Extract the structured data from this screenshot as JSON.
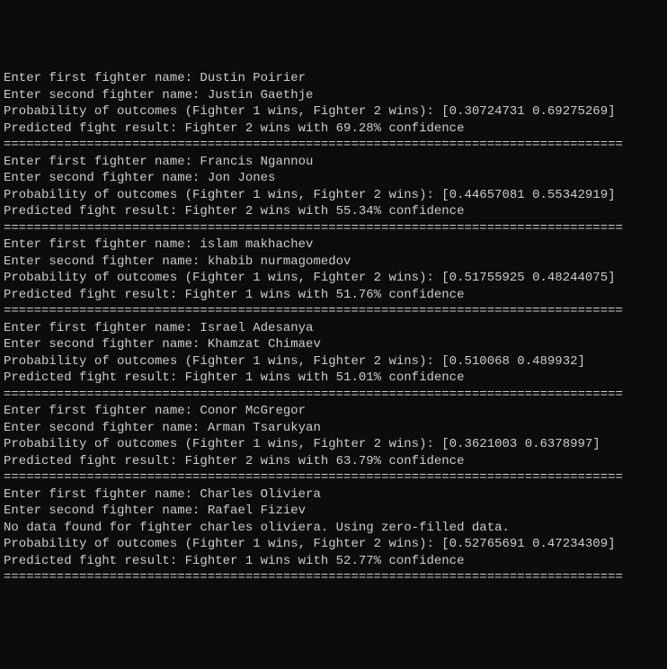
{
  "prompts": {
    "fighter1": "Enter first fighter name: ",
    "fighter2": "Enter second fighter name: ",
    "probability_prefix": "Probability of outcomes (Fighter 1 wins, Fighter 2 wins): ",
    "predicted_prefix": "Predicted fight result: ",
    "no_data_prefix": "No data found for fighter ",
    "no_data_suffix": ". Using zero-filled data."
  },
  "separator": "==================================================================================",
  "predictions": [
    {
      "fighter1": "Dustin Poirier",
      "fighter2": "Justin Gaethje",
      "probability": "[0.30724731 0.69275269]",
      "result": "Fighter 2 wins with 69.28% confidence"
    },
    {
      "fighter1": "Francis Ngannou",
      "fighter2": "Jon Jones",
      "probability": "[0.44657081 0.55342919]",
      "result": "Fighter 2 wins with 55.34% confidence"
    },
    {
      "fighter1": "islam makhachev",
      "fighter2": "khabib nurmagomedov",
      "probability": "[0.51755925 0.48244075]",
      "result": "Fighter 1 wins with 51.76% confidence"
    },
    {
      "fighter1": "Israel Adesanya",
      "fighter2": "Khamzat Chimaev",
      "probability": "[0.510068 0.489932]",
      "result": "Fighter 1 wins with 51.01% confidence"
    },
    {
      "fighter1": "Conor McGregor",
      "fighter2": "Arman Tsarukyan",
      "probability": "[0.3621003 0.6378997]",
      "result": "Fighter 2 wins with 63.79% confidence"
    },
    {
      "fighter1": "Charles Oliviera",
      "fighter2": "Rafael Fiziev",
      "no_data_name": "charles oliviera",
      "probability": "[0.52765691 0.47234309]",
      "result": "Fighter 1 wins with 52.77% confidence"
    }
  ]
}
